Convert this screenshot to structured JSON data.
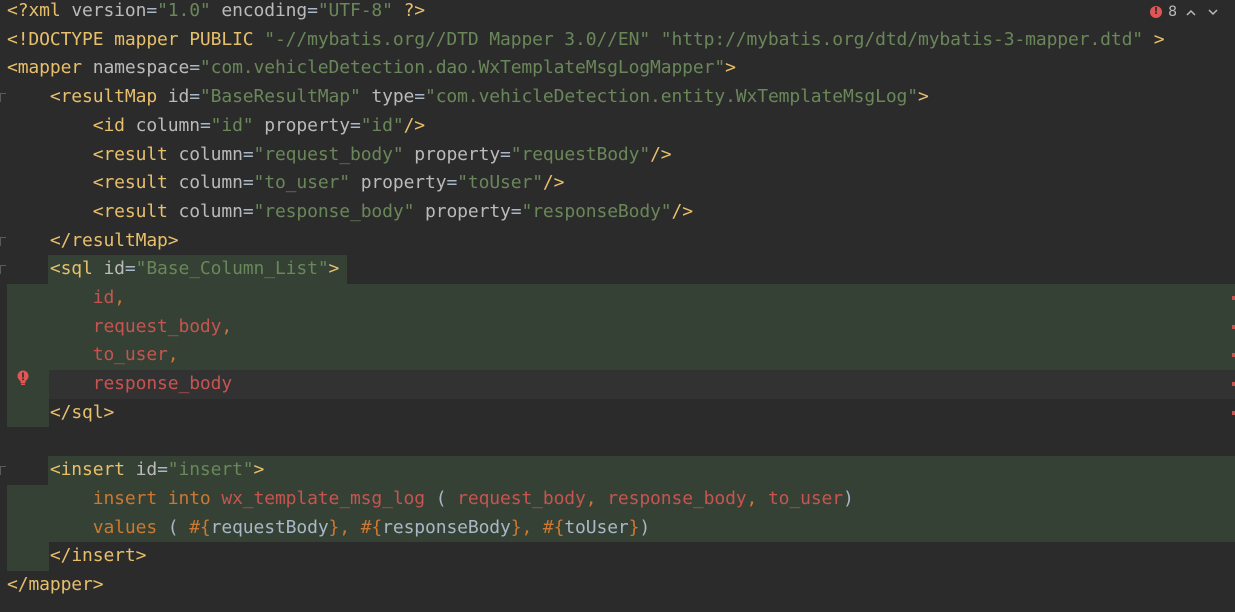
{
  "status": {
    "error_count": "8",
    "up_label": "^",
    "down_label": "v"
  },
  "lines": [
    [
      "<?xml version=\"1.0\" encoding=\"UTF-8\" ?>"
    ],
    [
      "<!DOCTYPE mapper PUBLIC \"-//mybatis.org//DTD Mapper 3.0//EN\" \"http://mybatis.org/dtd/mybatis-3-mapper.dtd\" >"
    ],
    [
      "<mapper namespace=\"com.vehicleDetection.dao.WxTemplateMsgLogMapper\">"
    ],
    [
      "    <resultMap id=\"BaseResultMap\" type=\"com.vehicleDetection.entity.WxTemplateMsgLog\">"
    ],
    [
      "        <id column=\"id\" property=\"id\"/>"
    ],
    [
      "        <result column=\"request_body\" property=\"requestBody\"/>"
    ],
    [
      "        <result column=\"to_user\" property=\"toUser\"/>"
    ],
    [
      "        <result column=\"response_body\" property=\"responseBody\"/>"
    ],
    [
      "    </resultMap>"
    ],
    [
      "    <sql id=\"Base_Column_List\">"
    ],
    [
      "        id,"
    ],
    [
      "        request_body,"
    ],
    [
      "        to_user,"
    ],
    [
      "        response_body"
    ],
    [
      "    </sql>"
    ],
    [
      ""
    ],
    [
      "    <insert id=\"insert\">"
    ],
    [
      "        insert into wx_template_msg_log ( request_body, response_body, to_user)"
    ],
    [
      "        values ( #{requestBody}, #{responseBody}, #{toUser})"
    ],
    [
      "    </insert>"
    ],
    [
      "</mapper>"
    ]
  ],
  "tokens": {
    "l0": [
      "<?",
      "xml ",
      "version",
      "=",
      "\"1.0\"",
      " ",
      "encoding",
      "=",
      "\"UTF-8\"",
      " ?>"
    ],
    "l1": [
      "<!DOCTYPE ",
      "mapper ",
      "PUBLIC ",
      "\"-//mybatis.org//DTD Mapper 3.0//EN\"",
      " ",
      "\"http://mybatis.org/dtd/mybatis-3-mapper.dtd\"",
      " >"
    ],
    "l2": [
      "<",
      "mapper",
      " ",
      "namespace",
      "=",
      "\"com.vehicleDetection.dao.WxTemplateMsgLogMapper\"",
      ">"
    ],
    "l3": [
      "    ",
      "<",
      "resultMap",
      " ",
      "id",
      "=",
      "\"BaseResultMap\"",
      " ",
      "type",
      "=",
      "\"com.vehicleDetection.entity.WxTemplateMsgLog\"",
      ">"
    ],
    "l4": [
      "        ",
      "<",
      "id",
      " ",
      "column",
      "=",
      "\"id\"",
      " ",
      "property",
      "=",
      "\"id\"",
      "/>"
    ],
    "l5": [
      "        ",
      "<",
      "result",
      " ",
      "column",
      "=",
      "\"request_body\"",
      " ",
      "property",
      "=",
      "\"requestBody\"",
      "/>"
    ],
    "l6": [
      "        ",
      "<",
      "result",
      " ",
      "column",
      "=",
      "\"to_user\"",
      " ",
      "property",
      "=",
      "\"toUser\"",
      "/>"
    ],
    "l7": [
      "        ",
      "<",
      "result",
      " ",
      "column",
      "=",
      "\"response_body\"",
      " ",
      "property",
      "=",
      "\"responseBody\"",
      "/>"
    ],
    "l8": [
      "    ",
      "</",
      "resultMap",
      ">"
    ],
    "l9": [
      "    ",
      "<",
      "sql",
      " ",
      "id",
      "=",
      "\"Base_Column_List\"",
      ">"
    ],
    "l10": [
      "        ",
      "id",
      ","
    ],
    "l11": [
      "        ",
      "request_body",
      ","
    ],
    "l12": [
      "        ",
      "to_user",
      ","
    ],
    "l13": [
      "        ",
      "response_body"
    ],
    "l14": [
      "    ",
      "</",
      "sql",
      ">"
    ],
    "l15": [],
    "l16": [
      "    ",
      "<",
      "insert",
      " ",
      "id",
      "=",
      "\"insert\"",
      ">"
    ],
    "l17": [
      "        ",
      "insert into ",
      "wx_template_msg_log",
      " ( ",
      "request_body",
      ", ",
      "response_body",
      ", ",
      "to_user",
      ")"
    ],
    "l18": [
      "        ",
      "values ",
      "( ",
      "#{",
      "requestBody",
      "}",
      ", ",
      "#{",
      "responseBody",
      "}",
      ", ",
      "#{",
      "toUser",
      "}",
      ")"
    ],
    "l19": [
      "    ",
      "</",
      "insert",
      ">"
    ],
    "l20": [
      "</",
      "mapper",
      ">"
    ]
  },
  "colors": {
    "background": "#2b2b2b",
    "tag": "#e8bf6a",
    "attribute": "#bababa",
    "string": "#6a8759",
    "keyword": "#cc7832",
    "column": "#c75450",
    "plain": "#a9b7c6",
    "highlight": "#344134",
    "error": "#e05555"
  },
  "icons": {
    "error_indicator": "error-dot-icon",
    "intention": "bulb-error-icon"
  }
}
